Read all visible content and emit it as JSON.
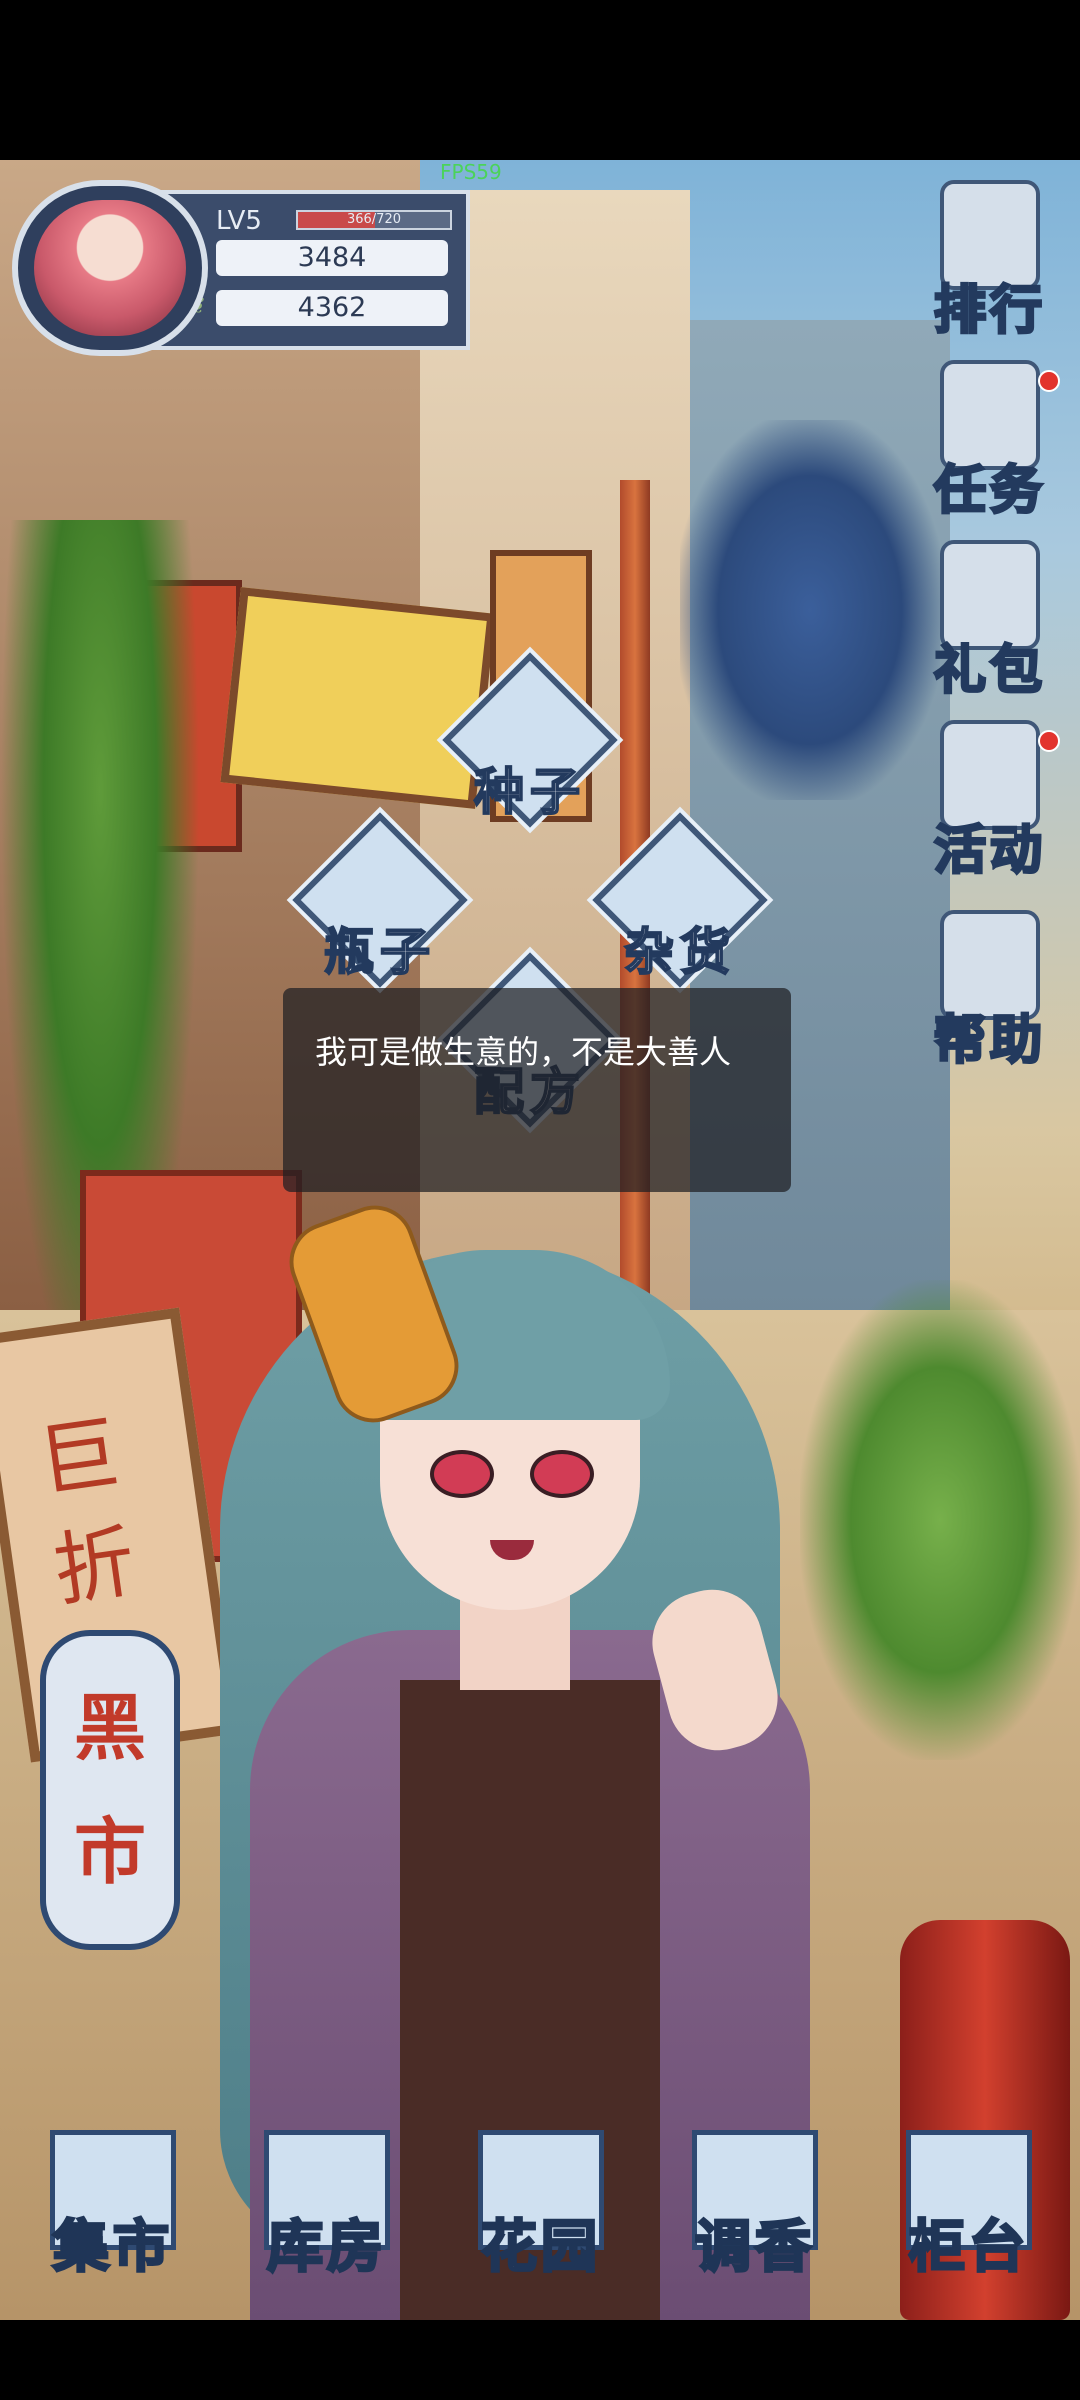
{
  "hud": {
    "fps": "FPS59",
    "level": "LV5",
    "xp_text": "366/720",
    "xp_fraction": 0.508,
    "heart_value": "3484",
    "leaf_value": "4362"
  },
  "side_menu": [
    {
      "label": "排行",
      "icon": "ranking-icon",
      "dot": false
    },
    {
      "label": "任务",
      "icon": "task-icon",
      "dot": true
    },
    {
      "label": "礼包",
      "icon": "gift-icon",
      "dot": false
    },
    {
      "label": "活动",
      "icon": "event-icon",
      "dot": true
    },
    {
      "label": "帮助",
      "icon": "help-icon",
      "dot": false
    }
  ],
  "shop_menu": {
    "seed": "种子",
    "bottle": "瓶子",
    "goods": "杂货",
    "recipe": "配方"
  },
  "dialog": {
    "text": "我可是做生意的，不是大善人"
  },
  "black_market": {
    "label_1": "黑",
    "label_2": "市"
  },
  "scene": {
    "sale_sign_1": "巨",
    "sale_sign_2": "折"
  },
  "bottom_nav": [
    {
      "label": "集市",
      "icon": "market-icon"
    },
    {
      "label": "库房",
      "icon": "warehouse-icon"
    },
    {
      "label": "花园",
      "icon": "garden-icon"
    },
    {
      "label": "调香",
      "icon": "perfume-icon"
    },
    {
      "label": "柜台",
      "icon": "counter-icon"
    }
  ],
  "colors": {
    "frame": "#2f4a72",
    "accent_red": "#e2332d"
  }
}
